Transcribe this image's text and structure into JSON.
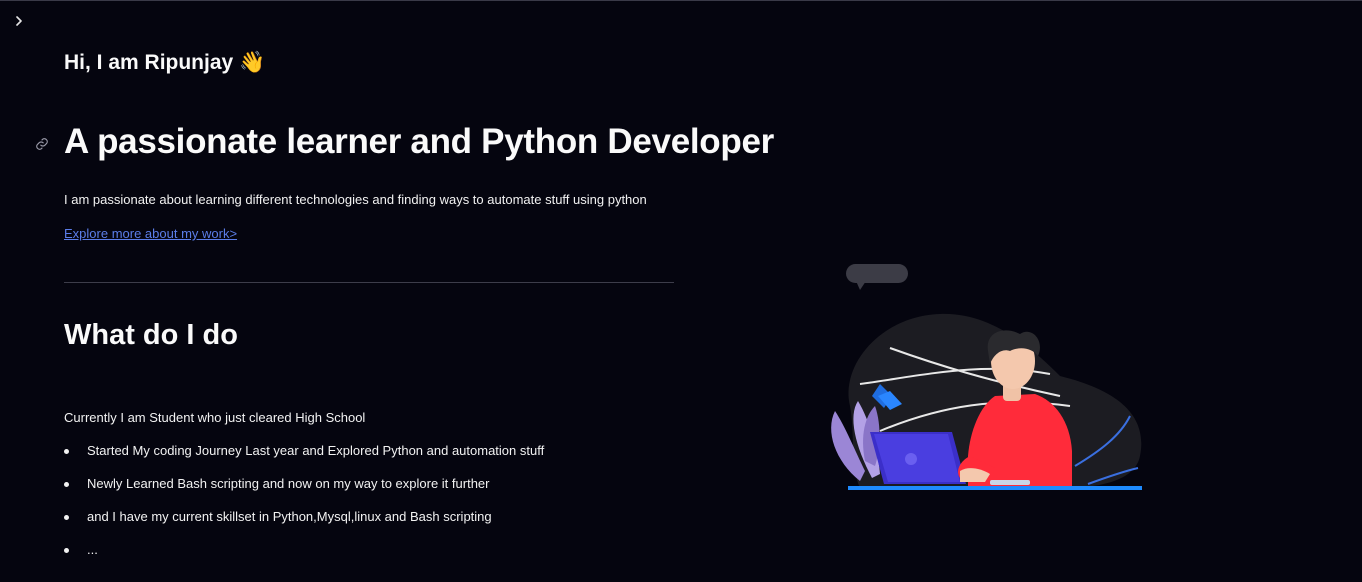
{
  "sidebar": {
    "toggle_icon": "chevron-right-icon"
  },
  "header": {
    "greeting": "Hi, I am Ripunjay 👋",
    "title": "A passionate learner and Python Developer",
    "intro": "I am passionate about learning different technologies and finding ways to automate stuff using python",
    "link_text": "Explore more about my work>"
  },
  "section": {
    "title": "What do I do",
    "status": "Currently I am Student who just cleared High School",
    "bullets": [
      "Started My coding Journey Last year and Explored Python and automation stuff",
      "Newly Learned Bash scripting and now on my way to explore it further",
      "and I have my current skillset in Python,Mysql,linux and Bash scripting",
      "..."
    ]
  },
  "illustration": {
    "icon": "developer-at-laptop-illustration"
  },
  "colors": {
    "background": "#05050f",
    "link": "#5b7de8",
    "accent": "#ff2b3a"
  }
}
